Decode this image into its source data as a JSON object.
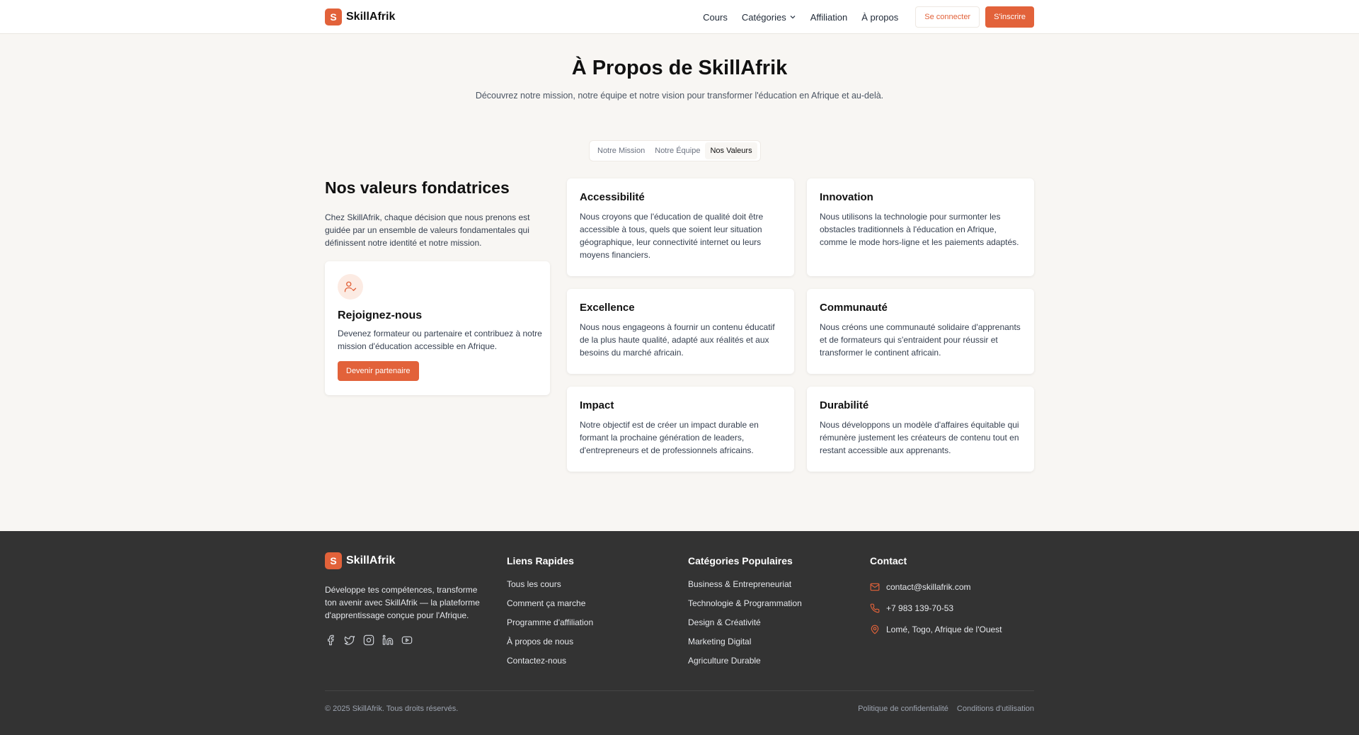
{
  "brand": {
    "initial": "S",
    "name": "SkillAfrik",
    "color": "#e2623a"
  },
  "nav": {
    "courses": "Cours",
    "categories": "Catégories",
    "affiliation": "Affiliation",
    "about": "À propos",
    "login": "Se connecter",
    "signup": "S'inscrire"
  },
  "hero": {
    "title": "À Propos de SkillAfrik",
    "subtitle": "Découvrez notre mission, notre équipe et notre vision pour transformer l'éducation en Afrique et au-delà."
  },
  "tabs": [
    {
      "label": "Notre Mission",
      "active": false
    },
    {
      "label": "Notre Équipe",
      "active": false
    },
    {
      "label": "Nos Valeurs",
      "active": true
    }
  ],
  "values_section": {
    "title": "Nos valeurs fondatrices",
    "description": "Chez SkillAfrik, chaque décision que nous prenons est guidée par un ensemble de valeurs fondamentales qui définissent notre identité et notre mission."
  },
  "join": {
    "icon": "user-check-icon",
    "title": "Rejoignez-nous",
    "description": "Devenez formateur ou partenaire et contribuez à notre mission d'éducation accessible en Afrique.",
    "button": "Devenir partenaire"
  },
  "values": [
    {
      "title": "Accessibilité",
      "text": "Nous croyons que l'éducation de qualité doit être accessible à tous, quels que soient leur situation géographique, leur connectivité internet ou leurs moyens financiers."
    },
    {
      "title": "Innovation",
      "text": "Nous utilisons la technologie pour surmonter les obstacles traditionnels à l'éducation en Afrique, comme le mode hors-ligne et les paiements adaptés."
    },
    {
      "title": "Excellence",
      "text": "Nous nous engageons à fournir un contenu éducatif de la plus haute qualité, adapté aux réalités et aux besoins du marché africain."
    },
    {
      "title": "Communauté",
      "text": "Nous créons une communauté solidaire d'apprenants et de formateurs qui s'entraident pour réussir et transformer le continent africain."
    },
    {
      "title": "Impact",
      "text": "Notre objectif est de créer un impact durable en formant la prochaine génération de leaders, d'entrepreneurs et de professionnels africains."
    },
    {
      "title": "Durabilité",
      "text": "Nous développons un modèle d'affaires équitable qui rémunère justement les créateurs de contenu tout en restant accessible aux apprenants."
    }
  ],
  "footer": {
    "about": "Développe tes compétences, transforme ton avenir avec SkillAfrik — la plateforme d'apprentissage conçue pour l'Afrique.",
    "socials": [
      "facebook-icon",
      "twitter-icon",
      "instagram-icon",
      "linkedin-icon",
      "youtube-icon"
    ],
    "quick_links": {
      "title": "Liens Rapides",
      "items": [
        "Tous les cours",
        "Comment ça marche",
        "Programme d'affiliation",
        "À propos de nous",
        "Contactez-nous"
      ]
    },
    "categories": {
      "title": "Catégories Populaires",
      "items": [
        "Business & Entrepreneuriat",
        "Technologie & Programmation",
        "Design & Créativité",
        "Marketing Digital",
        "Agriculture Durable"
      ]
    },
    "contact": {
      "title": "Contact",
      "email": "contact@skillafrik.com",
      "phone": "+7 983 139-70-53",
      "address": "Lomé, Togo, Afrique de l'Ouest"
    },
    "copyright": "© 2025 SkillAfrik. Tous droits réservés.",
    "privacy": "Politique de confidentialité",
    "terms": "Conditions d'utilisation"
  }
}
